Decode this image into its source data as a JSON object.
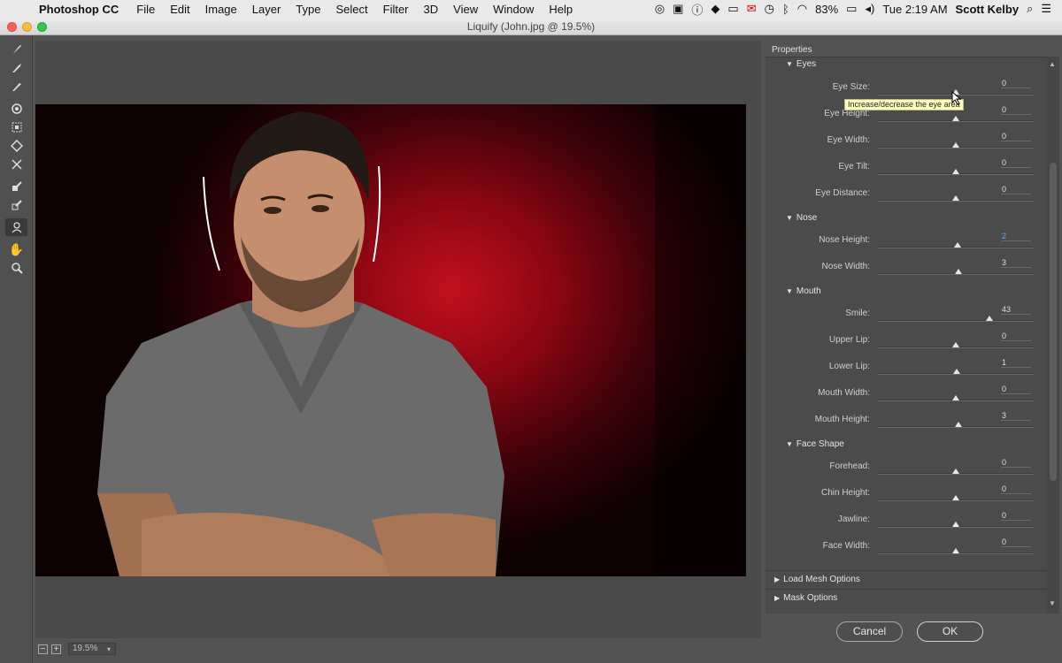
{
  "menubar": {
    "app": "Photoshop CC",
    "items": [
      "File",
      "Edit",
      "Image",
      "Layer",
      "Type",
      "Select",
      "Filter",
      "3D",
      "View",
      "Window",
      "Help"
    ],
    "battery": "83%",
    "clock": "Tue 2:19 AM",
    "user": "Scott Kelby"
  },
  "window": {
    "title": "Liquify (John.jpg @ 19.5%)"
  },
  "canvas": {
    "zoom": "19.5%"
  },
  "properties": {
    "title": "Properties",
    "tooltip": "Increase/decrease the eye area",
    "sections": [
      {
        "name": "Eyes",
        "rows": [
          {
            "label": "Eye Size:",
            "value": "0",
            "pos": 0.5
          },
          {
            "label": "Eye Height:",
            "value": "0",
            "pos": 0.5
          },
          {
            "label": "Eye Width:",
            "value": "0",
            "pos": 0.5
          },
          {
            "label": "Eye Tilt:",
            "value": "0",
            "pos": 0.5
          },
          {
            "label": "Eye Distance:",
            "value": "0",
            "pos": 0.5
          }
        ]
      },
      {
        "name": "Nose",
        "rows": [
          {
            "label": "Nose Height:",
            "value": "2",
            "pos": 0.51
          },
          {
            "label": "Nose Width:",
            "value": "3",
            "pos": 0.515
          }
        ]
      },
      {
        "name": "Mouth",
        "rows": [
          {
            "label": "Smile:",
            "value": "43",
            "pos": 0.715
          },
          {
            "label": "Upper Lip:",
            "value": "0",
            "pos": 0.5
          },
          {
            "label": "Lower Lip:",
            "value": "1",
            "pos": 0.505
          },
          {
            "label": "Mouth Width:",
            "value": "0",
            "pos": 0.5
          },
          {
            "label": "Mouth Height:",
            "value": "3",
            "pos": 0.515
          }
        ]
      },
      {
        "name": "Face Shape",
        "rows": [
          {
            "label": "Forehead:",
            "value": "0",
            "pos": 0.5
          },
          {
            "label": "Chin Height:",
            "value": "0",
            "pos": 0.5
          },
          {
            "label": "Jawline:",
            "value": "0",
            "pos": 0.5
          },
          {
            "label": "Face Width:",
            "value": "0",
            "pos": 0.5
          }
        ]
      }
    ],
    "load_mesh": "Load Mesh Options",
    "mask_options": "Mask Options"
  },
  "buttons": {
    "cancel": "Cancel",
    "ok": "OK"
  }
}
